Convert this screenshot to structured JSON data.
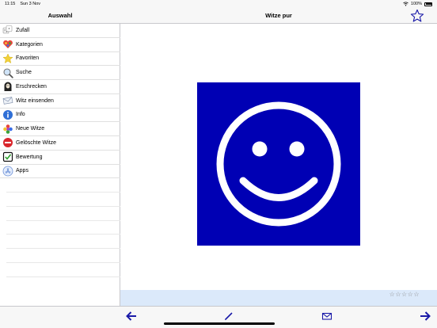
{
  "status": {
    "time": "11:15",
    "date": "Sun 3 Nov",
    "battery": "100%"
  },
  "sidebar": {
    "title": "Auswahl",
    "items": [
      {
        "label": "Zufall",
        "icon": "dice-icon"
      },
      {
        "label": "Kategorien",
        "icon": "heart-icon"
      },
      {
        "label": "Favoriten",
        "icon": "star-icon"
      },
      {
        "label": "Suche",
        "icon": "search-icon"
      },
      {
        "label": "Erschrecken",
        "icon": "ghost-icon"
      },
      {
        "label": "Witz einsenden",
        "icon": "envelope-icon"
      },
      {
        "label": "Info",
        "icon": "info-icon"
      },
      {
        "label": "Neue Witze",
        "icon": "flower-icon"
      },
      {
        "label": "Gelöschte Witze",
        "icon": "no-entry-icon"
      },
      {
        "label": "Bewertung",
        "icon": "checkmark-icon"
      },
      {
        "label": "Apps",
        "icon": "app-store-icon"
      }
    ]
  },
  "main": {
    "title": "Witze pur",
    "rating": "☆☆☆☆☆"
  },
  "colors": {
    "accent": "#1a1aa8",
    "smiley_bg": "#0000b4",
    "rating_bar": "#dbe9fa"
  }
}
